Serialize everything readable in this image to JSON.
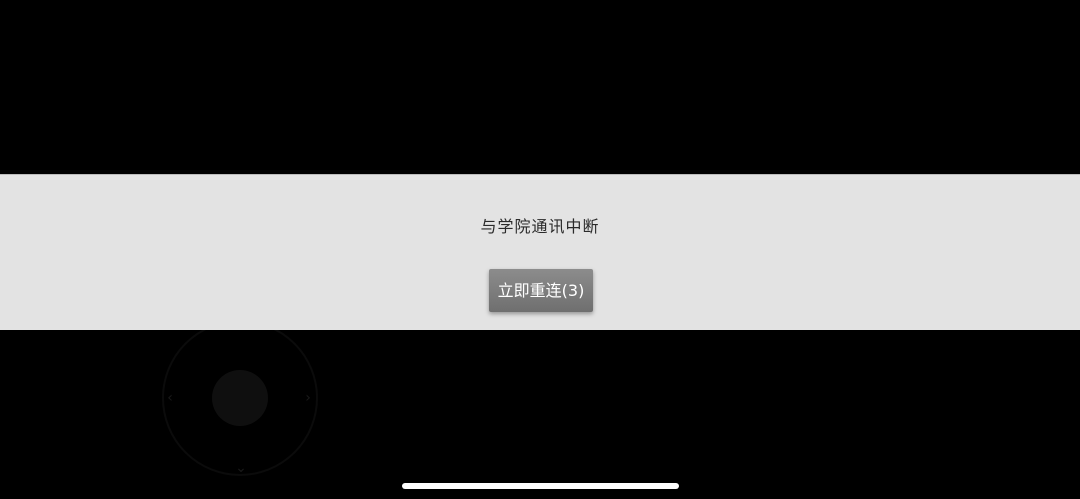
{
  "dialog": {
    "message": "与学院通讯中断",
    "reconnect_label": "立即重连(3)"
  },
  "joystick": {
    "left_icon": "chevron-left-icon",
    "right_icon": "chevron-right-icon",
    "down_icon": "chevron-down-icon"
  },
  "colors": {
    "background": "#000000",
    "banner": "#e3e3e3",
    "button": "#7f7f7f",
    "button_text": "#ffffff",
    "message_text": "#2a2a2a"
  }
}
